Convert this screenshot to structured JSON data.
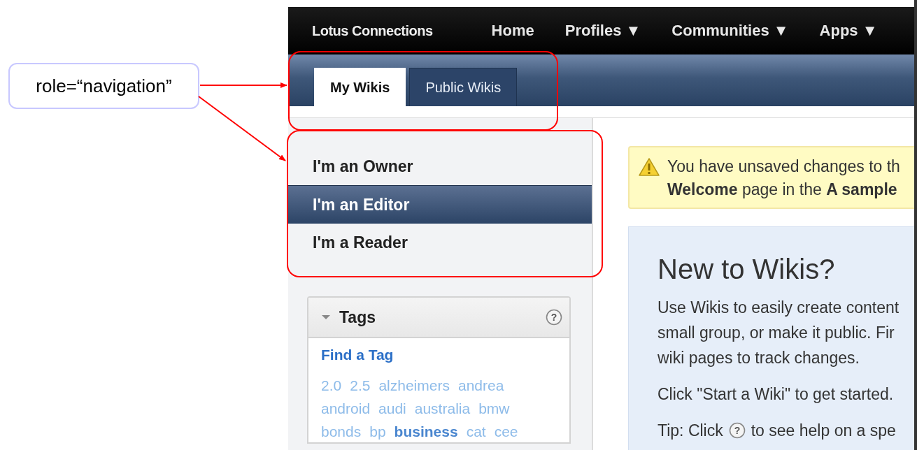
{
  "annotation": {
    "label": "role=“navigation”"
  },
  "header": {
    "brand": "Lotus Connections",
    "nav": [
      {
        "label": "Home"
      },
      {
        "label": "Profiles ▼"
      },
      {
        "label": "Communities ▼"
      },
      {
        "label": "Apps ▼"
      }
    ]
  },
  "tabs": [
    {
      "label": "My Wikis",
      "selected": true
    },
    {
      "label": "Public Wikis",
      "selected": false
    }
  ],
  "sidebar": {
    "items": [
      {
        "label": "I'm an Owner",
        "selected": false
      },
      {
        "label": "I'm an Editor",
        "selected": true
      },
      {
        "label": "I'm a Reader",
        "selected": false
      }
    ],
    "tags_panel": {
      "title": "Tags",
      "help_icon": "?",
      "expanded": true,
      "find_link": "Find a Tag",
      "tags": [
        {
          "label": "2.0",
          "popular": false
        },
        {
          "label": "2.5",
          "popular": false
        },
        {
          "label": "alzheimers",
          "popular": false
        },
        {
          "label": "andrea",
          "popular": false
        },
        {
          "label": "android",
          "popular": false
        },
        {
          "label": "audi",
          "popular": false
        },
        {
          "label": "australia",
          "popular": false
        },
        {
          "label": "bmw",
          "popular": false
        },
        {
          "label": "bonds",
          "popular": false
        },
        {
          "label": "bp",
          "popular": false
        },
        {
          "label": "business",
          "popular": true
        },
        {
          "label": "cat",
          "popular": false
        },
        {
          "label": "cee",
          "popular": false
        }
      ]
    }
  },
  "warning": {
    "lines": [
      "You have unsaved changes to th",
      "**Welcome** page in the **A sample**"
    ]
  },
  "intro": {
    "title": "New to Wikis?",
    "paragraphs": [
      [
        "Use Wikis to easily create content",
        "small group, or make it public. Fir",
        "wiki pages to track changes."
      ],
      [
        "Click \"Start a Wiki\" to get started."
      ]
    ],
    "tip_before": "Tip: Click",
    "help_icon": "?",
    "tip_after": "to see help on a spe"
  }
}
